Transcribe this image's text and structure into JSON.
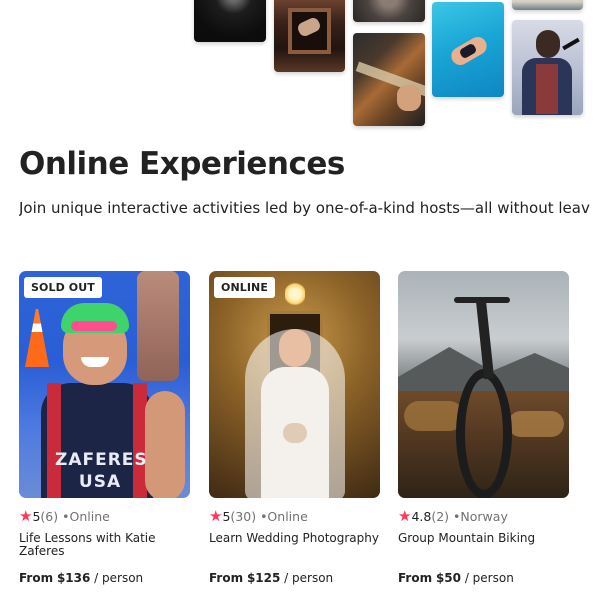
{
  "section": {
    "title": "Online Experiences",
    "subtitle": "Join unique interactive activities led by one-of-a-kind hosts—all without leav"
  },
  "cards": [
    {
      "badge": "SOLD OUT",
      "rating": "5",
      "reviews": "(6)",
      "location": "•Online",
      "title": "Life Lessons with Katie Zaferes",
      "price_prefix": "From",
      "price": "$136",
      "unit": "/ person",
      "photo_text": "ZAFERES\nUSA"
    },
    {
      "badge": "ONLINE",
      "rating": "5",
      "reviews": "(30)",
      "location": "•Online",
      "title": "Learn Wedding Photography",
      "price_prefix": "From",
      "price": "$125",
      "unit": "/ person"
    },
    {
      "badge": "",
      "rating": "4.8",
      "reviews": "(2)",
      "location": "•Norway",
      "title": "Group Mountain Biking",
      "price_prefix": "From",
      "price": "$50",
      "unit": "/ person"
    }
  ],
  "icons": {
    "rating": "star-icon"
  },
  "colors": {
    "star": "#ff385c",
    "text": "#222222",
    "muted": "#717171"
  }
}
